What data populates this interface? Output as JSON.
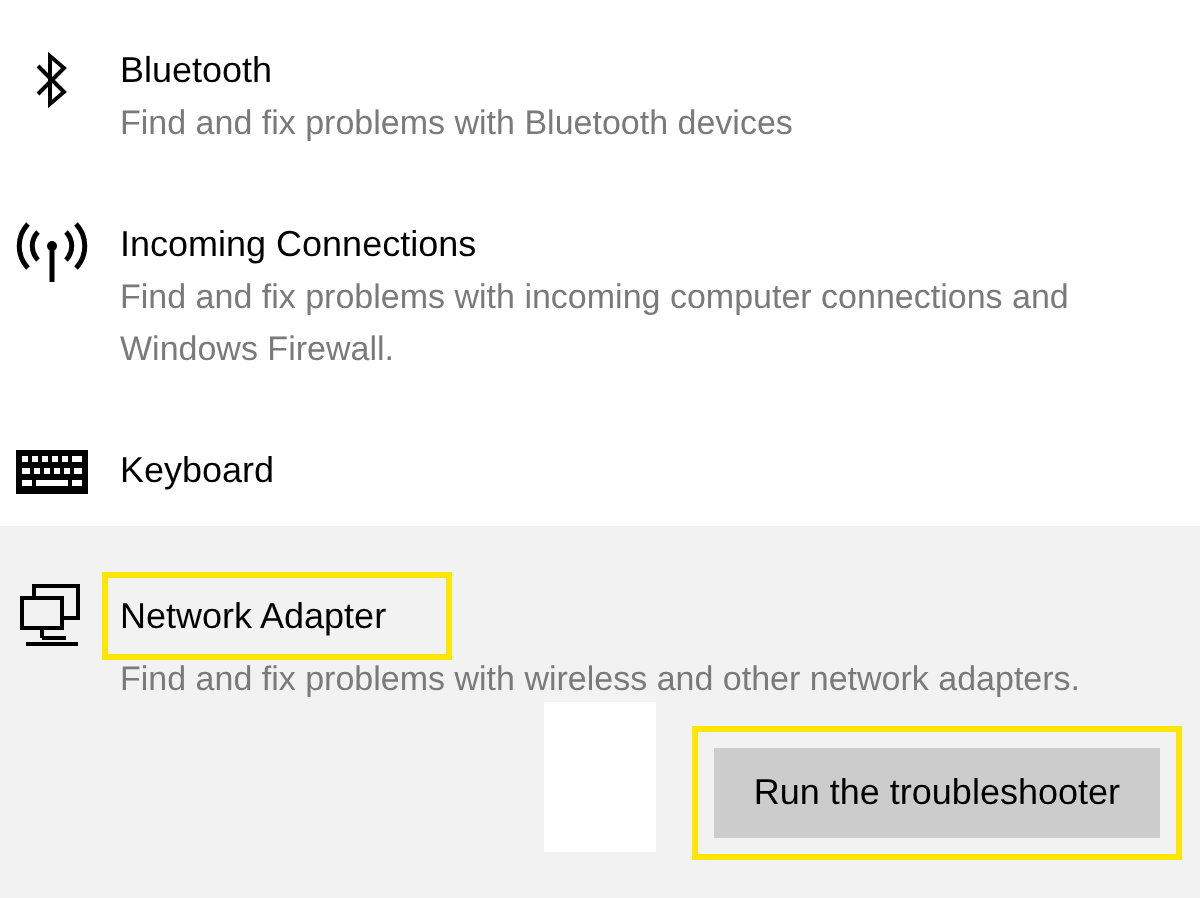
{
  "items": [
    {
      "kind": "bluetooth",
      "title": "Bluetooth",
      "description": "Find and fix problems with Bluetooth devices",
      "selected": false,
      "highlighted": false
    },
    {
      "kind": "antenna",
      "title": "Incoming Connections",
      "description": "Find and fix problems with incoming computer connections and Windows Firewall.",
      "selected": false,
      "highlighted": false
    },
    {
      "kind": "keyboard",
      "title": "Keyboard",
      "selected": false,
      "highlighted": false
    },
    {
      "kind": "network",
      "title": "Network Adapter",
      "description": "Find and fix problems with wireless and other network adapters.",
      "selected": true,
      "highlighted": true,
      "button": {
        "label": "Run the troubleshooter",
        "highlighted": true
      }
    }
  ]
}
